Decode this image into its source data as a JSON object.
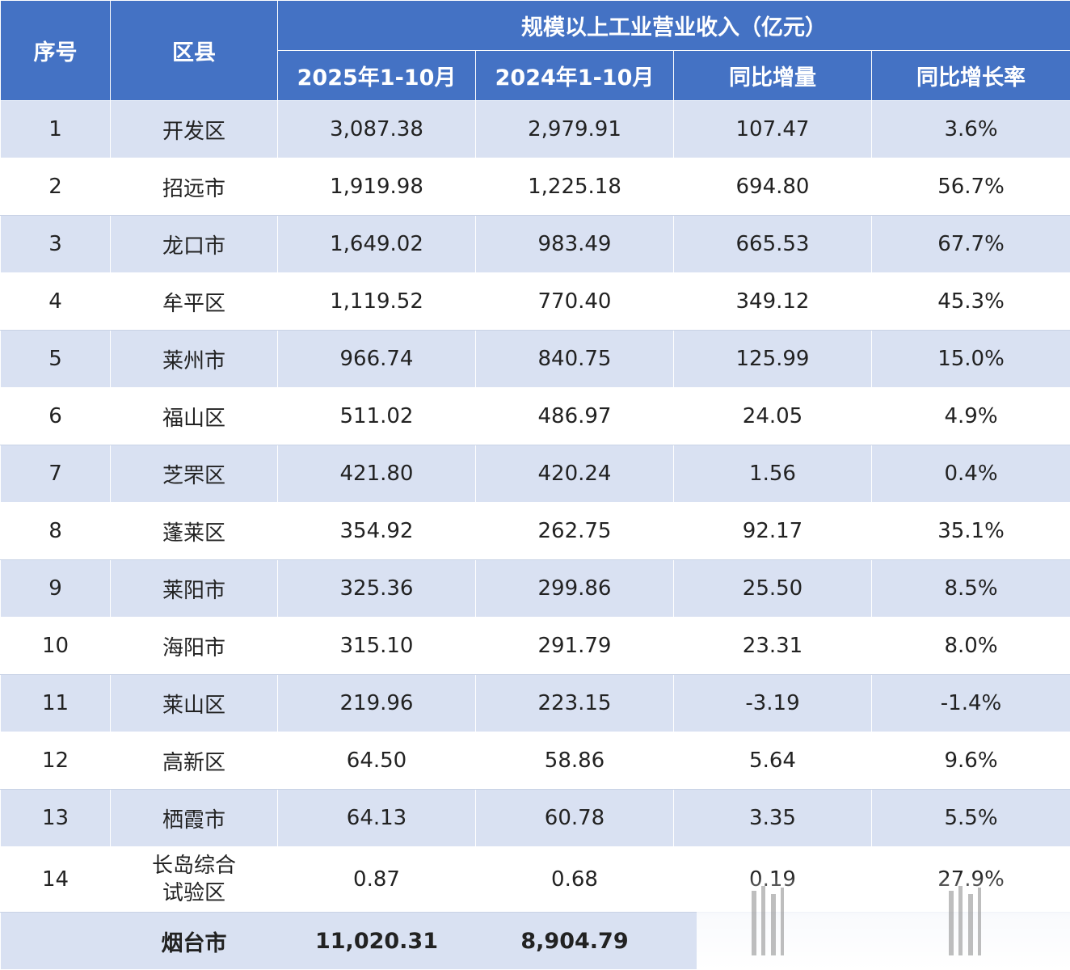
{
  "table": {
    "headers": {
      "index": "序号",
      "district": "区县",
      "group": "规模以上工业营业收入（亿元）",
      "col_2025": "2025年1-10月",
      "col_2024": "2024年1-10月",
      "col_change": "同比增量",
      "col_rate": "同比增长率"
    },
    "rows": [
      {
        "index": "1",
        "district": "开发区",
        "v2025": "3,087.38",
        "v2024": "2,979.91",
        "change": "107.47",
        "rate": "3.6%"
      },
      {
        "index": "2",
        "district": "招远市",
        "v2025": "1,919.98",
        "v2024": "1,225.18",
        "change": "694.80",
        "rate": "56.7%"
      },
      {
        "index": "3",
        "district": "龙口市",
        "v2025": "1,649.02",
        "v2024": "983.49",
        "change": "665.53",
        "rate": "67.7%"
      },
      {
        "index": "4",
        "district": "牟平区",
        "v2025": "1,119.52",
        "v2024": "770.40",
        "change": "349.12",
        "rate": "45.3%"
      },
      {
        "index": "5",
        "district": "莱州市",
        "v2025": "966.74",
        "v2024": "840.75",
        "change": "125.99",
        "rate": "15.0%"
      },
      {
        "index": "6",
        "district": "福山区",
        "v2025": "511.02",
        "v2024": "486.97",
        "change": "24.05",
        "rate": "4.9%"
      },
      {
        "index": "7",
        "district": "芝罘区",
        "v2025": "421.80",
        "v2024": "420.24",
        "change": "1.56",
        "rate": "0.4%"
      },
      {
        "index": "8",
        "district": "蓬莱区",
        "v2025": "354.92",
        "v2024": "262.75",
        "change": "92.17",
        "rate": "35.1%"
      },
      {
        "index": "9",
        "district": "莱阳市",
        "v2025": "325.36",
        "v2024": "299.86",
        "change": "25.50",
        "rate": "8.5%"
      },
      {
        "index": "10",
        "district": "海阳市",
        "v2025": "315.10",
        "v2024": "291.79",
        "change": "23.31",
        "rate": "8.0%"
      },
      {
        "index": "11",
        "district": "莱山区",
        "v2025": "219.96",
        "v2024": "223.15",
        "change": "-3.19",
        "rate": "-1.4%"
      },
      {
        "index": "12",
        "district": "高新区",
        "v2025": "64.50",
        "v2024": "58.86",
        "change": "5.64",
        "rate": "9.6%"
      },
      {
        "index": "13",
        "district": "栖霞市",
        "v2025": "64.13",
        "v2024": "60.78",
        "change": "3.35",
        "rate": "5.5%"
      },
      {
        "index": "14",
        "district_line1": "长岛综合",
        "district_line2": "试验区",
        "v2025": "0.87",
        "v2024": "0.68",
        "change": "0.19",
        "rate": "27.9%"
      }
    ],
    "total": {
      "district": "烟台市",
      "v2025": "11,020.31",
      "v2024": "8,904.79"
    }
  },
  "colors": {
    "header_bg": "#4472c4",
    "band_bg": "#d9e1f2"
  }
}
